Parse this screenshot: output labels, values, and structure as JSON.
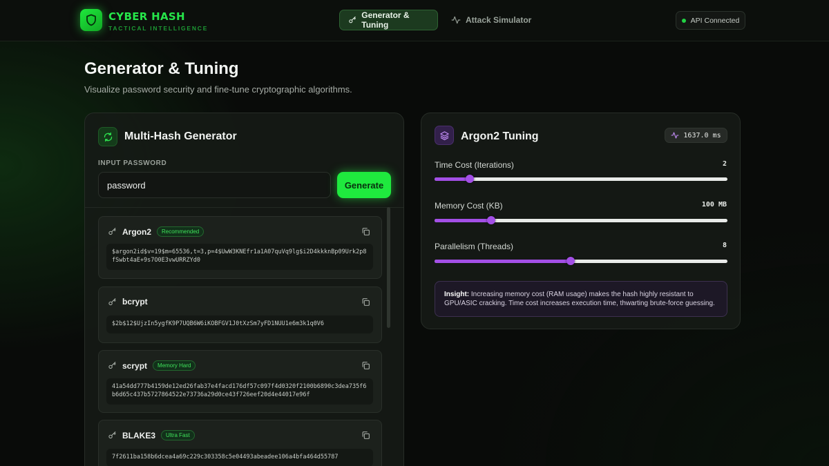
{
  "brand": {
    "title": "CYBER HASH",
    "subtitle": "TACTICAL INTELLIGENCE",
    "logo_icon": "shield-icon",
    "accent": "#22e64a"
  },
  "nav": {
    "tabs": [
      {
        "label": "Generator & Tuning",
        "icon": "key-icon",
        "active": true
      },
      {
        "label": "Attack Simulator",
        "icon": "activity-icon",
        "active": false
      }
    ]
  },
  "status": {
    "label": "API Connected",
    "color": "#22d244"
  },
  "page": {
    "title": "Generator & Tuning",
    "subtitle": "Visualize password security and fine-tune cryptographic algorithms."
  },
  "generator": {
    "title": "Multi-Hash Generator",
    "icon": "refresh-icon",
    "input_label": "INPUT PASSWORD",
    "input_value": "password",
    "button_label": "Generate",
    "hashes": [
      {
        "name": "Argon2",
        "badge": "Recommended",
        "value": "$argon2id$v=19$m=65536,t=3,p=4$UwW3KNEfr1a1A07quVq9lg$i2D4kkknBp09Urk2p8fSwbt4aE+9s7O0E3vwURRZYd0"
      },
      {
        "name": "bcrypt",
        "badge": "",
        "value": "$2b$12$UjzIn5ygfK9P7UQB6W6iKOBFGV1J0tXzSm7yFD1NUU1e6m3k1q0V6"
      },
      {
        "name": "scrypt",
        "badge": "Memory Hard",
        "value": "41a54dd777b4159de12ed26fab37e4facd176df57c097f4d0320f2100b6890c3dea735f6b6d65c437b5727864522e73736a29d0ce43f726eef20d4e44017e96f"
      },
      {
        "name": "BLAKE3",
        "badge": "Ultra Fast",
        "value": "7f2611ba158b6dcea4a69c229c303358c5e04493abeadee106a4bfa464d55787"
      }
    ]
  },
  "tuning": {
    "title": "Argon2 Tuning",
    "icon": "layers-icon",
    "timer": "1637.0 ms",
    "accent": "#a34fe6",
    "sliders": [
      {
        "label": "Time Cost (Iterations)",
        "value": "2",
        "fraction": 0.12
      },
      {
        "label": "Memory Cost (KB)",
        "value": "100 MB",
        "fraction": 0.193
      },
      {
        "label": "Parallelism (Threads)",
        "value": "8",
        "fraction": 0.465
      }
    ],
    "insight": {
      "lead": "Insight:",
      "text": "Increasing memory cost (RAM usage) makes the hash highly resistant to GPU/ASIC cracking. Time cost increases execution time, thwarting brute-force guessing."
    }
  }
}
